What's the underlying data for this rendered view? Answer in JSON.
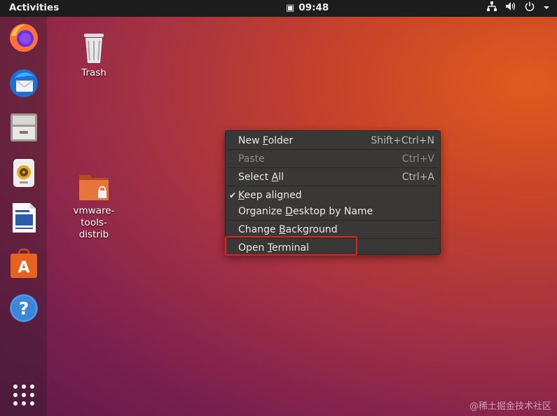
{
  "topbar": {
    "activities": "Activities",
    "clock": "09:48",
    "clock_icon": "calendar-icon"
  },
  "tray": {
    "network": "network-icon",
    "volume": "volume-icon",
    "power": "power-icon"
  },
  "dock": [
    {
      "name": "Firefox",
      "icon": "firefox-icon"
    },
    {
      "name": "Thunderbird",
      "icon": "thunderbird-icon"
    },
    {
      "name": "Files",
      "icon": "files-icon"
    },
    {
      "name": "Rhythmbox",
      "icon": "rhythmbox-icon"
    },
    {
      "name": "LibreOffice Writer",
      "icon": "writer-icon"
    },
    {
      "name": "Ubuntu Software",
      "icon": "software-icon"
    },
    {
      "name": "Help",
      "icon": "help-icon"
    },
    {
      "name": "Show Applications",
      "icon": "app-grid-icon"
    }
  ],
  "desktop": {
    "trash_label": "Trash",
    "folder_line1": "vmware-",
    "folder_line2": "tools-",
    "folder_line3": "distrib"
  },
  "context_menu": {
    "new_folder": {
      "pre": "New ",
      "ul": "F",
      "post": "older",
      "accel": "Shift+Ctrl+N"
    },
    "paste": {
      "label": "Paste",
      "accel": "Ctrl+V"
    },
    "select_all": {
      "pre": "Select ",
      "ul": "A",
      "post": "ll",
      "accel": "Ctrl+A"
    },
    "keep_aligned": {
      "ul": "K",
      "post": "eep aligned",
      "check": "✔"
    },
    "organize": {
      "pre": "Organize ",
      "ul": "D",
      "post": "esktop by Name"
    },
    "change_bg": {
      "pre": "Change ",
      "ul": "B",
      "post": "ackground"
    },
    "open_terminal": {
      "pre": "Open ",
      "ul": "T",
      "post": "erminal"
    }
  },
  "watermark": "@稀土掘金技术社区"
}
